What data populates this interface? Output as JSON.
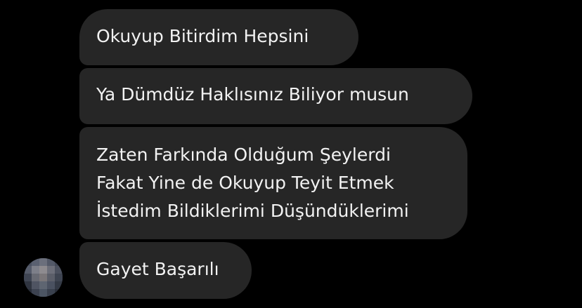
{
  "conversation": {
    "messages": [
      {
        "lines": [
          "Okuyup Bitirdim Hepsini"
        ]
      },
      {
        "lines": [
          "Ya Dümdüz Haklısınız Biliyor musun"
        ]
      },
      {
        "lines": [
          "Zaten Farkında Olduğum Şeylerdi",
          "Fakat Yine de Okuyup Teyit Etmek",
          "İstedim Bildiklerimi Düşündüklerimi"
        ]
      },
      {
        "lines": [
          "Gayet Başarılı"
        ]
      }
    ],
    "sender_avatar": {
      "icon": "blurred-profile-photo"
    }
  },
  "colors": {
    "background": "#000000",
    "bubble": "#262626",
    "text": "#f2f2f2"
  }
}
